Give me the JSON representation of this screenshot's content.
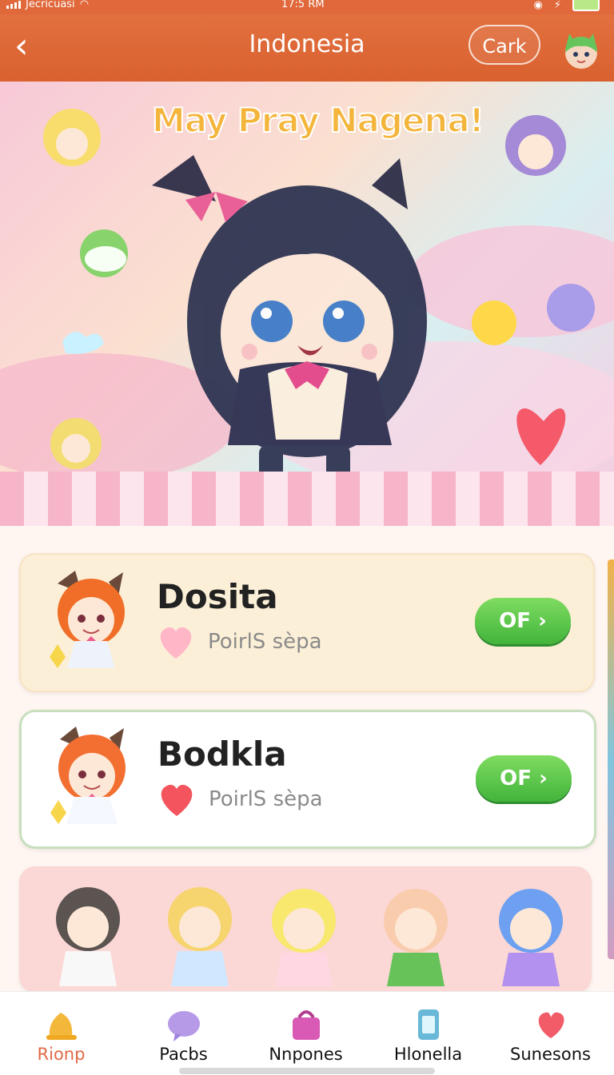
{
  "status": {
    "carrier": "Jecricuasi",
    "time": "17:5 RM"
  },
  "header": {
    "title": "Indonesia",
    "back_glyph": "‹",
    "right_button": "Cark"
  },
  "hero": {
    "title": "May Pray Nagena!"
  },
  "cards": [
    {
      "name": "Dosita",
      "subtitle": "PoirlS sèpa",
      "button": "OF ›",
      "heart_color": "#ffb7c8"
    },
    {
      "name": "Bodkla",
      "subtitle": "PoirlS sèpa",
      "button": "OF ›",
      "heart_color": "#f3545d"
    }
  ],
  "tabs": [
    {
      "label": "Rionp",
      "icon": "bell-icon",
      "color": "#f3b83b",
      "active": true
    },
    {
      "label": "Pacbs",
      "icon": "heart-bubble-icon",
      "color": "#b69ae8",
      "active": false
    },
    {
      "label": "Nnpones",
      "icon": "bag-icon",
      "color": "#d85ab5",
      "active": false
    },
    {
      "label": "Hlonella",
      "icon": "phone-icon",
      "color": "#68b8d8",
      "active": false
    },
    {
      "label": "Sunesons",
      "icon": "chat-heart-icon",
      "color": "#f15c68",
      "active": false
    }
  ],
  "colors": {
    "accent": "#e0683a",
    "button_green": "#42b43b"
  }
}
